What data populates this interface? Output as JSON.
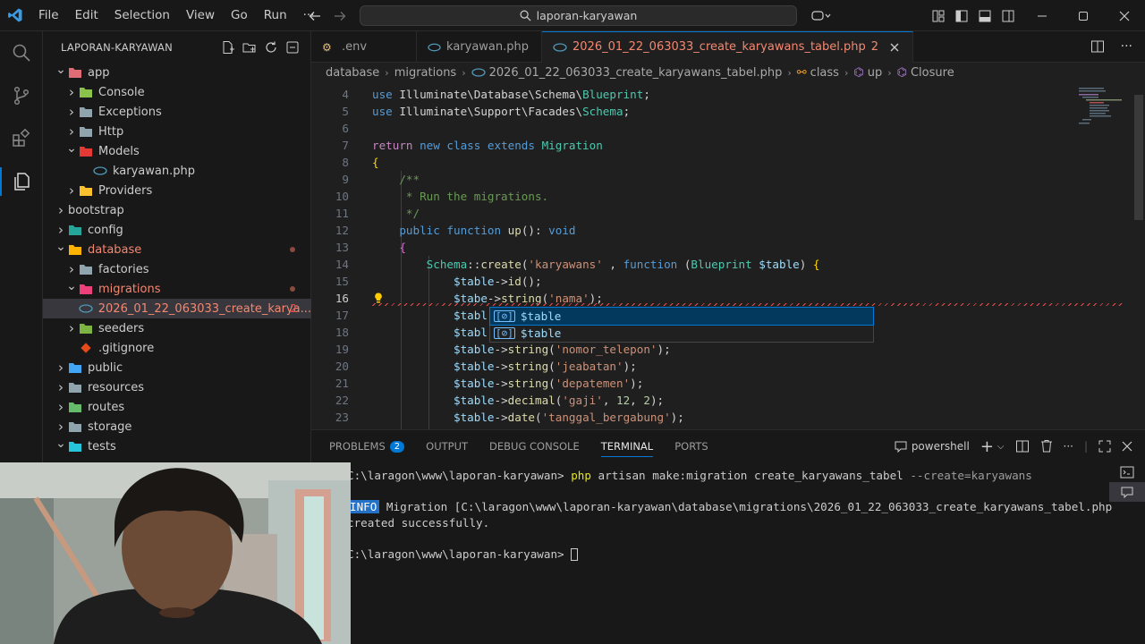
{
  "titlebar": {
    "menu": [
      "File",
      "Edit",
      "Selection",
      "View",
      "Go",
      "Run",
      "···"
    ],
    "search": "laporan-karyawan"
  },
  "sidebar": {
    "title": "LAPORAN-KARYAWAN",
    "items": [
      {
        "label": "app",
        "depth": 1,
        "chev": "down",
        "kind": "folder-app",
        "color": "#e06c75"
      },
      {
        "label": "Console",
        "depth": 2,
        "chev": "right",
        "kind": "folder",
        "color": "#8bc34a"
      },
      {
        "label": "Exceptions",
        "depth": 2,
        "chev": "right",
        "kind": "folder",
        "color": "#90a4ae"
      },
      {
        "label": "Http",
        "depth": 2,
        "chev": "right",
        "kind": "folder",
        "color": "#90a4ae"
      },
      {
        "label": "Models",
        "depth": 2,
        "chev": "down",
        "kind": "folder",
        "color": "#e53935"
      },
      {
        "label": "karyawan.php",
        "depth": 3,
        "chev": "none",
        "kind": "php",
        "color": "#519aba"
      },
      {
        "label": "Providers",
        "depth": 2,
        "chev": "right",
        "kind": "folder",
        "color": "#fbc02d"
      },
      {
        "label": "bootstrap",
        "depth": 1,
        "chev": "right",
        "kind": "none",
        "color": ""
      },
      {
        "label": "config",
        "depth": 1,
        "chev": "right",
        "kind": "folder",
        "color": "#26a69a"
      },
      {
        "label": "database",
        "depth": 1,
        "chev": "down",
        "kind": "folder",
        "color": "#ffb300",
        "modified": true
      },
      {
        "label": "factories",
        "depth": 2,
        "chev": "right",
        "kind": "folder",
        "color": "#90a4ae"
      },
      {
        "label": "migrations",
        "depth": 2,
        "chev": "down",
        "kind": "folder",
        "color": "#ec407a",
        "modified": true
      },
      {
        "label": "2026_01_22_063033_create_karya...",
        "depth": 3,
        "chev": "none",
        "kind": "php",
        "color": "#519aba",
        "selected": true,
        "count": "2"
      },
      {
        "label": "seeders",
        "depth": 2,
        "chev": "right",
        "kind": "folder",
        "color": "#7cb342"
      },
      {
        "label": ".gitignore",
        "depth": 2,
        "chev": "none",
        "kind": "git",
        "color": "#e64a19"
      },
      {
        "label": "public",
        "depth": 1,
        "chev": "right",
        "kind": "folder",
        "color": "#42a5f5"
      },
      {
        "label": "resources",
        "depth": 1,
        "chev": "right",
        "kind": "folder",
        "color": "#90a4ae"
      },
      {
        "label": "routes",
        "depth": 1,
        "chev": "right",
        "kind": "folder",
        "color": "#66bb6a"
      },
      {
        "label": "storage",
        "depth": 1,
        "chev": "right",
        "kind": "folder",
        "color": "#90a4ae"
      },
      {
        "label": "tests",
        "depth": 1,
        "chev": "down",
        "kind": "folder",
        "color": "#26c6da"
      }
    ]
  },
  "tabs": [
    {
      "label": ".env",
      "active": false
    },
    {
      "label": "karyawan.php",
      "active": false
    },
    {
      "label": "2026_01_22_063033_create_karyawans_tabel.php",
      "active": true,
      "count": "2"
    }
  ],
  "breadcrumb": [
    "database",
    "migrations",
    "2026_01_22_063033_create_karyawans_tabel.php",
    "class",
    "up",
    "Closure"
  ],
  "editor": {
    "lines": [
      {
        "n": "4",
        "tokens": [
          [
            "k",
            "use "
          ],
          [
            "",
            "Illuminate\\Database\\Schema\\"
          ],
          [
            "t",
            "Blueprint"
          ],
          [
            "",
            ";"
          ]
        ]
      },
      {
        "n": "5",
        "tokens": [
          [
            "k",
            "use "
          ],
          [
            "",
            "Illuminate\\Support\\Facades\\"
          ],
          [
            "t",
            "Schema"
          ],
          [
            "",
            ";"
          ]
        ]
      },
      {
        "n": "6",
        "tokens": []
      },
      {
        "n": "7",
        "tokens": [
          [
            "kc",
            "return "
          ],
          [
            "k",
            "new class extends "
          ],
          [
            "t",
            "Migration"
          ]
        ]
      },
      {
        "n": "8",
        "tokens": [
          [
            "y",
            "{"
          ]
        ]
      },
      {
        "n": "9",
        "tokens": [
          [
            "c",
            "    /**"
          ]
        ]
      },
      {
        "n": "10",
        "tokens": [
          [
            "c",
            "     * Run the migrations."
          ]
        ]
      },
      {
        "n": "11",
        "tokens": [
          [
            "c",
            "     */"
          ]
        ]
      },
      {
        "n": "12",
        "tokens": [
          [
            "k",
            "    public function "
          ],
          [
            "f",
            "up"
          ],
          [
            "",
            "(): "
          ],
          [
            "k",
            "void"
          ]
        ]
      },
      {
        "n": "13",
        "tokens": [
          [
            "p",
            "    {"
          ]
        ]
      },
      {
        "n": "14",
        "tokens": [
          [
            "t",
            "        Schema"
          ],
          [
            "",
            "::"
          ],
          [
            "f",
            "create"
          ],
          [
            "",
            "("
          ],
          [
            "s",
            "'karyawans'"
          ],
          [
            "",
            " , "
          ],
          [
            "k",
            "function "
          ],
          [
            "",
            "("
          ],
          [
            "t",
            "Blueprint "
          ],
          [
            "v",
            "$table"
          ],
          [
            "",
            ") "
          ],
          [
            "y",
            "{"
          ]
        ]
      },
      {
        "n": "15",
        "tokens": [
          [
            "v",
            "            $table"
          ],
          [
            "",
            "->"
          ],
          [
            "f",
            "id"
          ],
          [
            "",
            "();"
          ]
        ]
      },
      {
        "n": "16",
        "tokens": [
          [
            "v",
            "            $tabe"
          ],
          [
            "",
            "->"
          ],
          [
            "f",
            "string"
          ],
          [
            "",
            "("
          ],
          [
            "s",
            "'nama'"
          ],
          [
            "",
            ");"
          ]
        ],
        "current": true,
        "error": true
      },
      {
        "n": "17",
        "tokens": [
          [
            "v",
            "            $tabl"
          ]
        ]
      },
      {
        "n": "18",
        "tokens": [
          [
            "v",
            "            $tabl"
          ]
        ]
      },
      {
        "n": "19",
        "tokens": [
          [
            "v",
            "            $table"
          ],
          [
            "",
            "->"
          ],
          [
            "f",
            "string"
          ],
          [
            "",
            "("
          ],
          [
            "s",
            "'nomor_telepon'"
          ],
          [
            "",
            ");"
          ]
        ]
      },
      {
        "n": "20",
        "tokens": [
          [
            "v",
            "            $table"
          ],
          [
            "",
            "->"
          ],
          [
            "f",
            "string"
          ],
          [
            "",
            "("
          ],
          [
            "s",
            "'jeabatan'"
          ],
          [
            "",
            ");"
          ]
        ]
      },
      {
        "n": "21",
        "tokens": [
          [
            "v",
            "            $table"
          ],
          [
            "",
            "->"
          ],
          [
            "f",
            "string"
          ],
          [
            "",
            "("
          ],
          [
            "s",
            "'depatemen'"
          ],
          [
            "",
            ");"
          ]
        ]
      },
      {
        "n": "22",
        "tokens": [
          [
            "v",
            "            $table"
          ],
          [
            "",
            "->"
          ],
          [
            "f",
            "decimal"
          ],
          [
            "",
            "("
          ],
          [
            "s",
            "'gaji'"
          ],
          [
            "",
            ", "
          ],
          [
            "n",
            "12"
          ],
          [
            "",
            ", "
          ],
          [
            "n",
            "2"
          ],
          [
            "",
            ");"
          ]
        ]
      },
      {
        "n": "23",
        "tokens": [
          [
            "v",
            "            $table"
          ],
          [
            "",
            "->"
          ],
          [
            "f",
            "date"
          ],
          [
            "",
            "("
          ],
          [
            "s",
            "'tanggal_bergabung'"
          ],
          [
            "",
            ");"
          ]
        ]
      }
    ],
    "suggestions": [
      "$table",
      "$table"
    ]
  },
  "panel": {
    "tabs": [
      {
        "label": "PROBLEMS",
        "badge": "2"
      },
      {
        "label": "OUTPUT"
      },
      {
        "label": "DEBUG CONSOLE"
      },
      {
        "label": "TERMINAL",
        "active": true
      },
      {
        "label": "PORTS"
      }
    ],
    "shell": "powershell",
    "terminal": {
      "cmd_prompt": "C:\\laragon\\www\\laporan-karyawan> ",
      "cmd_php": "php",
      "cmd_args": " artisan make:migration create_karyawans_tabel",
      "cmd_flag": " --create=karyawans",
      "info_tag": "INFO",
      "info_text": " Migration [C:\\laragon\\www\\laporan-karyawan\\database\\migrations\\2026_01_22_063033_create_karyawans_tabel.php",
      "info_text2": "created successfully.",
      "prompt2": "C:\\laragon\\www\\laporan-karyawan> "
    }
  }
}
